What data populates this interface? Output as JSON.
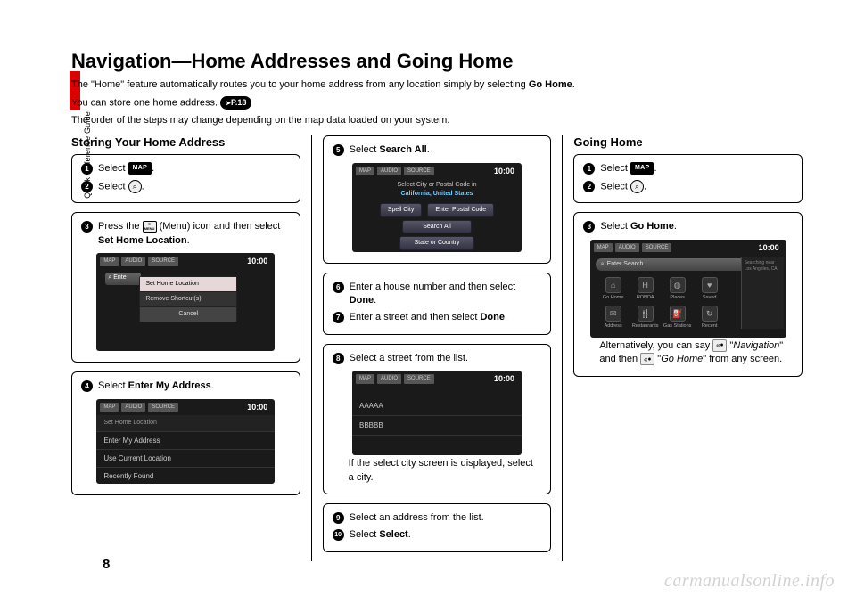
{
  "page_number": "8",
  "side_label": "Quick Reference Guide",
  "watermark": "carmanualsonline.info",
  "title": "Navigation—Home Addresses and Going Home",
  "intro": {
    "line1_a": "The \"Home\" feature automatically routes you to your home address from any location simply by selecting ",
    "line1_b": "Go Home",
    "line1_c": ".",
    "line2_a": "You can store one home address. ",
    "page_ref": "P.18",
    "line3": "The order of the steps may change depending on the map data loaded on your system."
  },
  "col1": {
    "heading": "Storing Your Home Address",
    "s1_a": "Select ",
    "s1_icon": "MAP",
    "s2_a": "Select ",
    "s3_a": "Press the ",
    "s3_b": " (Menu) icon and then select ",
    "s3_c": "Set Home Location",
    "s4_a": "Select ",
    "s4_b": "Enter My Address",
    "shot1": {
      "time": "10:00",
      "opt1": "Set Home Location",
      "opt2": "Remove Shortcut(s)",
      "cancel": "Cancel",
      "search": "Ente"
    },
    "shot2": {
      "time": "10:00",
      "hdr": "Set Home Location",
      "r1": "Enter My Address",
      "r2": "Use Current Location",
      "r3": "Recently Found"
    }
  },
  "col2": {
    "s5_a": "Select ",
    "s5_b": "Search All",
    "shot3": {
      "time": "10:00",
      "banner_a": "Select City or Postal Code in",
      "banner_b": "California, United States",
      "b1": "Spell City",
      "b2": "Enter Postal Code",
      "b3": "Search All",
      "b4": "State or Country"
    },
    "s6_a": "Enter a house number and then select ",
    "s6_b": "Done",
    "s7_a": "Enter a street and then select ",
    "s7_b": "Done",
    "s8": "Select a street from the list.",
    "shot4": {
      "time": "10:00",
      "r1": "AAAAA",
      "r2": "BBBBB"
    },
    "s8_note": "If the select city screen is displayed, select a city.",
    "s9": "Select an address from the list.",
    "s10_a": "Select ",
    "s10_b": "Select"
  },
  "col3": {
    "heading": "Going Home",
    "s1_a": "Select ",
    "s1_icon": "MAP",
    "s2_a": "Select ",
    "s3_a": "Select ",
    "s3_b": "Go Home",
    "shot5": {
      "time": "10:00",
      "search": "Enter Search",
      "c1": "Go Home",
      "c2": "HONDA",
      "c3": "Places",
      "c4": "Saved",
      "c5": "Address",
      "c6": "Restaurants",
      "c7": "Gas Stations",
      "c8": "Recent",
      "weather_t": "Searching near",
      "weather_l": "Los Angeles, CA"
    },
    "alt_a": "Alternatively, you can say ",
    "alt_b": "Navigation",
    "alt_c": " and then ",
    "alt_d": "Go Home",
    "alt_e": " from any screen."
  }
}
